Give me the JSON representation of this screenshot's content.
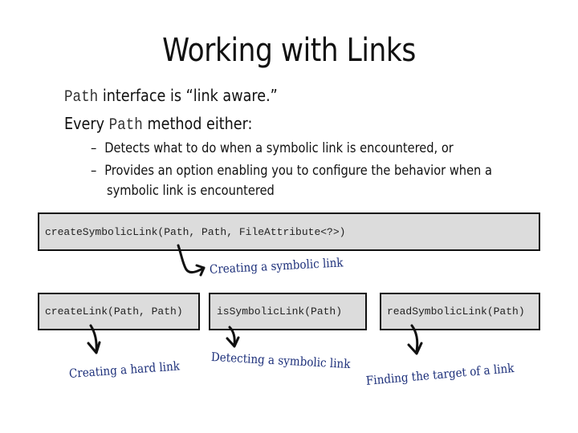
{
  "slide": {
    "title": "Working with Links",
    "bullets": [
      {
        "code": "Path",
        "text": " interface is “link aware.”"
      },
      {
        "prefix": "Every ",
        "code": "Path",
        "text": " method either:"
      }
    ],
    "sub_bullets": [
      {
        "dash": "–",
        "text": "Detects what to do when a symbolic link is encountered, or"
      },
      {
        "dash": "–",
        "text": "Provides an option enabling you to configure the behavior when a",
        "continuation": "symbolic link is encountered"
      }
    ]
  },
  "diagram": {
    "methods": [
      {
        "id": "create-symbolic-link",
        "signature": "createSymbolicLink(Path, Path, FileAttribute<?>)",
        "annotation": "Creating a symbolic link"
      },
      {
        "id": "create-link",
        "signature": "createLink(Path, Path)",
        "annotation": "Creating a hard link"
      },
      {
        "id": "is-symbolic-link",
        "signature": "isSymbolicLink(Path)",
        "annotation": "Detecting a symbolic link"
      },
      {
        "id": "read-symbolic-link",
        "signature": "readSymbolicLink(Path)",
        "annotation": "Finding the target of a link"
      }
    ],
    "colors": {
      "box_fill": "#dcdcdc",
      "box_border": "#111111",
      "annotation_text": "#1c2f7a",
      "arrow": "#111111"
    }
  }
}
